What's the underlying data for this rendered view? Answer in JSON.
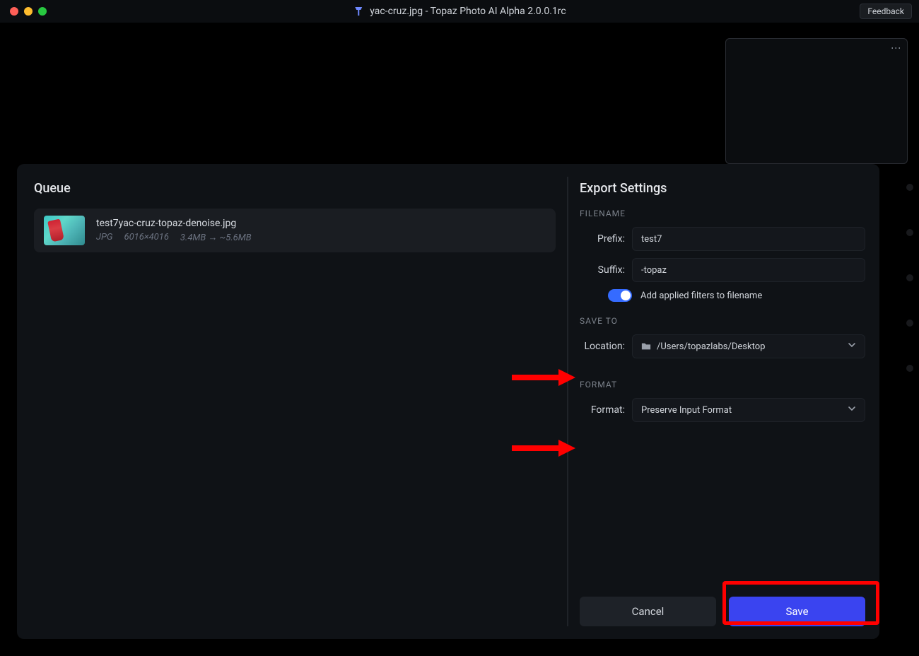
{
  "titlebar": {
    "title": "yac-cruz.jpg - Topaz Photo AI Alpha 2.0.0.1rc",
    "feedback": "Feedback"
  },
  "dialog": {
    "queue_title": "Queue",
    "export_title": "Export Settings",
    "queue_item": {
      "name": "test7yac-cruz-topaz-denoise.jpg",
      "format": "JPG",
      "dimensions": "6016×4016",
      "size_from": "3.4MB",
      "size_arrow": "→",
      "size_to": "~5.6MB"
    },
    "filename": {
      "header": "FILENAME",
      "prefix_label": "Prefix:",
      "prefix_value": "test7",
      "suffix_label": "Suffix:",
      "suffix_value": "-topaz",
      "toggle_label": "Add applied filters to filename"
    },
    "saveto": {
      "header": "SAVE TO",
      "location_label": "Location:",
      "location_value": "/Users/topazlabs/Desktop"
    },
    "format": {
      "header": "FORMAT",
      "format_label": "Format:",
      "format_value": "Preserve Input Format"
    },
    "actions": {
      "cancel": "Cancel",
      "save": "Save"
    }
  }
}
